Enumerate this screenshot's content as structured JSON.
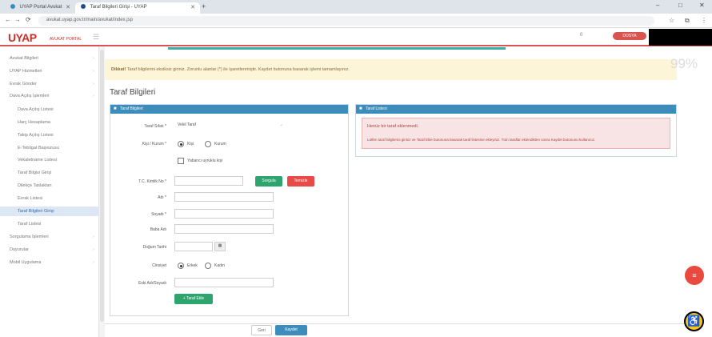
{
  "browser": {
    "tabs": [
      {
        "title": "UYAP Portal Avukat",
        "active": false
      },
      {
        "title": "Taraf Bilgileri Girişi - UYAP",
        "active": true
      }
    ],
    "url": "avukat.uyap.gov.tr/main/avukat/index.jsp",
    "nav": {
      "back": "←",
      "forward": "→",
      "reload": "⟳"
    },
    "window": {
      "minimize": "–",
      "maximize": "□",
      "close": "✕"
    }
  },
  "header": {
    "logo": "UYAP",
    "logo_sub": "AVUKAT PORTAL",
    "menu_icon": "☰",
    "badge": "0",
    "action_button": "DOSYA SORGULA"
  },
  "sidebar": {
    "items": [
      {
        "label": "Avukat Bilgileri",
        "sub": false
      },
      {
        "label": "UYAP Hizmetleri",
        "sub": false
      },
      {
        "label": "Evrak Gönder",
        "sub": false
      },
      {
        "label": "Dava Açılış İşlemleri",
        "sub": false,
        "active": true
      },
      {
        "label": "Dava Açılış Listesi",
        "sub": true
      },
      {
        "label": "Harç Hesaplama",
        "sub": true
      },
      {
        "label": "Takip Açılış Listesi",
        "sub": true
      },
      {
        "label": "E-Tebligat Başvurusu",
        "sub": true
      },
      {
        "label": "Vekaletname Listesi",
        "sub": true
      },
      {
        "label": "Taraf Bilgisi Girişi",
        "sub": true
      },
      {
        "label": "Dilekçe Taslakları",
        "sub": true
      },
      {
        "label": "Evrak Listesi",
        "sub": true
      },
      {
        "label": "Taraf Bilgileri Girişi",
        "sub": true,
        "active": true
      },
      {
        "label": "Taraf Listesi",
        "sub": true
      },
      {
        "label": "Sorgulama İşlemleri",
        "sub": false
      },
      {
        "label": "Duyurular",
        "sub": false
      },
      {
        "label": "Mobil Uygulama",
        "sub": false
      }
    ]
  },
  "alert": {
    "bold": "Dikkat!",
    "text": "Taraf bilgilerini eksiksiz giriniz. Zorunlu alanlar (*) ile işaretlenmiştir. Kaydet butonuna basarak işlemi tamamlayınız."
  },
  "progress_text": "99%",
  "page_title": "Taraf Bilgileri",
  "form_panel": {
    "title": "Taraf Bilgileri",
    "fields": {
      "taraf_sifati": {
        "label": "Taraf Sıfatı *",
        "value": "Vekil Taraf"
      },
      "kisi_kurum": {
        "label": "Kişi / Kurum *",
        "options": [
          "Kişi",
          "Kurum"
        ],
        "selected": "Kişi"
      },
      "yabanci_checkbox": {
        "label": "Yabancı uyruklu kişi",
        "checked": false
      },
      "tc_kimlik": {
        "label": "T.C. Kimlik No *",
        "value": ""
      },
      "sorgula_button": "Sorgula",
      "temizle_button": "Temizle",
      "adi": {
        "label": "Adı *",
        "value": ""
      },
      "soyadi": {
        "label": "Soyadı *",
        "value": ""
      },
      "baba_adi": {
        "label": "Baba Adı",
        "value": ""
      },
      "dogum_tarihi": {
        "label": "Doğum Tarihi",
        "value": ""
      },
      "cinsiyet": {
        "label": "Cinsiyet",
        "options": [
          "Erkek",
          "Kadın"
        ],
        "selected": "Erkek"
      },
      "eski_adsoyad": {
        "label": "Eski Adı/Soyadı",
        "value": ""
      },
      "ekle_button": "Taraf Ekle"
    }
  },
  "info_panel": {
    "title": "Taraf Listesi",
    "heading": "Henüz bir taraf eklenmedi.",
    "text": "Lütfen taraf bilgilerini giriniz ve Taraf Ekle butonuna basarak taraf listesine ekleyiniz. Tüm taraflar eklendikten sonra Kaydet butonunu kullanınız."
  },
  "footer_buttons": {
    "back": "Geri",
    "save": "Kaydet"
  },
  "colors": {
    "brand": "#c9302c",
    "primary": "#3c8dbc",
    "success": "#2ea56f",
    "danger": "#e84a4a",
    "warning_bg": "#fcf5d8"
  }
}
